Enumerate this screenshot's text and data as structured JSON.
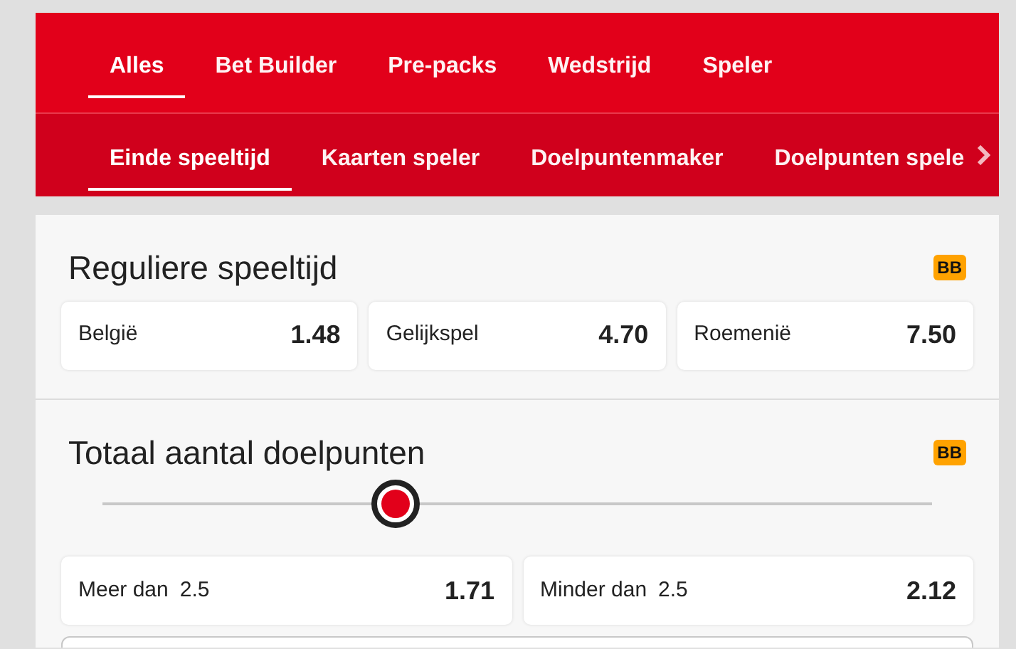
{
  "tabs": [
    {
      "label": "Alles",
      "selected": true
    },
    {
      "label": "Bet Builder",
      "selected": false
    },
    {
      "label": "Pre-packs",
      "selected": false
    },
    {
      "label": "Wedstrijd",
      "selected": false
    },
    {
      "label": "Speler",
      "selected": false
    }
  ],
  "subtabs": [
    {
      "label": "Einde speeltijd",
      "selected": true
    },
    {
      "label": "Kaarten speler",
      "selected": false
    },
    {
      "label": "Doelpuntenmaker",
      "selected": false
    },
    {
      "label": "Doelpunten spele",
      "selected": false
    }
  ],
  "markets": [
    {
      "kind": "odds",
      "title": "Reguliere speeltijd",
      "badge": "BB",
      "options": [
        {
          "label": "België",
          "odds": "1.48"
        },
        {
          "label": "Gelijkspel",
          "odds": "4.70"
        },
        {
          "label": "Roemenië",
          "odds": "7.50"
        }
      ]
    },
    {
      "kind": "line",
      "title": "Totaal aantal doelpunten",
      "badge": "BB",
      "options": [
        {
          "label": "Meer dan",
          "line": "2.5",
          "odds": "1.71"
        },
        {
          "label": "Minder dan",
          "line": "2.5",
          "odds": "2.12"
        }
      ]
    }
  ]
}
